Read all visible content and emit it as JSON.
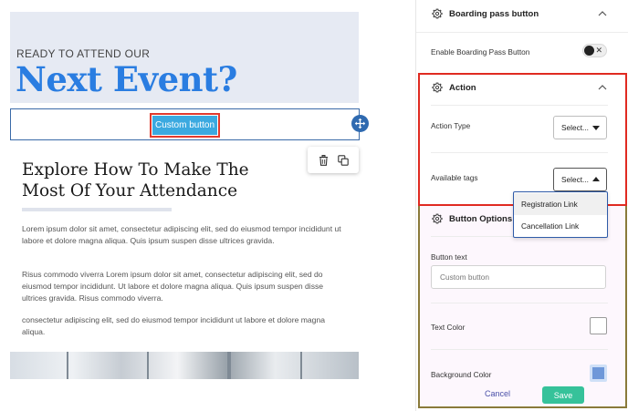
{
  "canvas": {
    "eyebrow": "READY TO ATTEND OUR",
    "hero_title": "Next Event?",
    "custom_button_label": "Custom button",
    "section_title": "Explore How To Make The Most Of Your Attendance",
    "paragraphs": [
      "Lorem ipsum dolor sit amet, consectetur adipiscing elit, sed do eiusmod tempor incididunt ut labore et dolore magna aliqua. Quis ipsum suspen disse ultrices gravida.",
      "Risus commodo viverra Lorem ipsum dolor sit amet, consectetur adipiscing elit, sed do eiusmod tempor incididunt. Ut labore et dolore magna aliqua. Quis ipsum suspen disse ultrices gravida. Risus commodo viverra.",
      "consectetur adipiscing elit, sed do eiusmod tempor incididunt ut labore et dolore magna aliqua."
    ],
    "toolbar_icons": [
      "move-icon",
      "trash-icon",
      "duplicate-icon"
    ]
  },
  "panel": {
    "boarding_section_title": "Boarding pass button",
    "enable_boarding_label": "Enable Boarding Pass Button",
    "enable_boarding_on": false,
    "action_section_title": "Action",
    "action_type_label": "Action Type",
    "action_type_value": "Select...",
    "available_tags_label": "Available tags",
    "available_tags_value": "Select...",
    "tag_options": [
      "Registration Link",
      "Cancellation Link"
    ],
    "button_options_title": "Button Options",
    "button_text_label": "Button text",
    "button_text_value": "Custom button",
    "text_color_label": "Text Color",
    "background_color_label": "Background Color",
    "cancel_label": "Cancel",
    "save_label": "Save"
  },
  "colors": {
    "hero_title": "#2a7de1",
    "custom_button_bg": "#3ba9e0",
    "highlight_red": "#e02a21",
    "text_color_swatch": "#ffffff",
    "background_color_swatch": "#6f98d9",
    "save_button": "#36c29a",
    "cancel_link": "#4a4fa8"
  }
}
